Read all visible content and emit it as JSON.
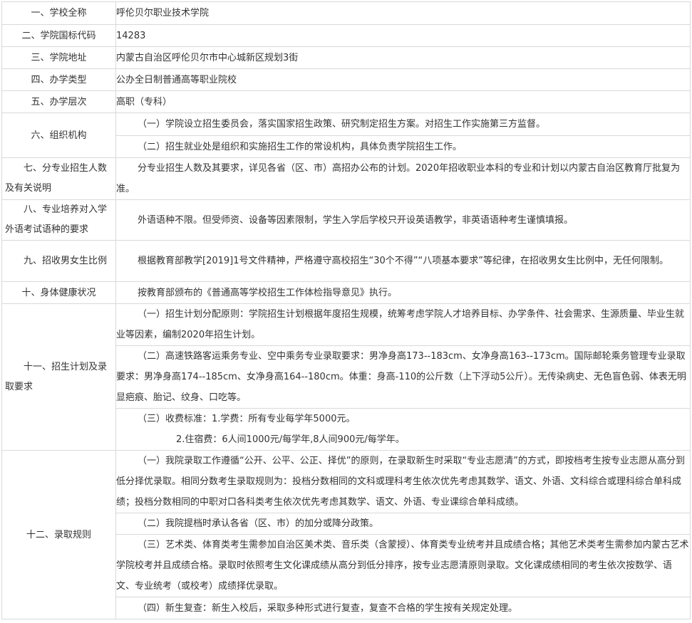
{
  "rows": [
    {
      "label": "一、学校全称",
      "value": "呼伦贝尔职业技术学院"
    },
    {
      "label": "二、学院国标代码",
      "value": "14283"
    },
    {
      "label": "三、学院地址",
      "value": "内蒙古自治区呼伦贝尔市中心城新区规划3街"
    },
    {
      "label": "四、办学类型",
      "value": "公办全日制普通高等职业院校"
    },
    {
      "label": "五、办学层次",
      "value": "高职（专科）"
    }
  ],
  "org": {
    "label": "六、组织机构",
    "items": [
      "（一）学院设立招生委员会，落实国家招生政策、研究制定招生方案。对招生工作实施第三方监督。",
      "（二）招生就业处是组织和实施招生工作的常设机构，具体负责学院招生工作。"
    ]
  },
  "quota": {
    "label": "七、分专业招生人数及有关说明",
    "text": "分专业招生人数及其要求，详见各省（区、市）高招办公布的计划。2020年招收职业本科的专业和计划以内蒙古自治区教育厅批复为准。"
  },
  "lang": {
    "label": "八、专业培养对入学外语考试语种的要求",
    "text": "外语语种不限。但受师资、设备等因素限制，学生入学后学校只开设英语教学，非英语语种考生谨慎填报。"
  },
  "gender": {
    "label": "九、招收男女生比例",
    "text": "根据教育部教学[2019]1号文件精神，严格遵守高校招生“30个不得”“八项基本要求”等纪律，在招收男女生比例中，无任何限制。"
  },
  "health": {
    "label": "十、身体健康状况",
    "text": "按教育部颁布的《普通高等学校招生工作体检指导意见》执行。"
  },
  "plan": {
    "label": "十一、招生计划及录取要求",
    "items": [
      "（一）招生计划分配原则：学院招生计划根据年度招生规模，统筹考虑学院人才培养目标、办学条件、社会需求、生源质量、毕业生就业等因素，编制2020年招生计划。",
      "（二）高速铁路客运乘务专业、空中乘务专业录取要求：男净身高173--183cm、女净身高163--173cm。国际邮轮乘务管理专业录取要求：男净身高174--185cm、女净身高164--180cm。体重：身高-110的公斤数（上下浮动5公斤）。无传染病史、无色盲色弱、体表无明显疤痕、胎记、纹身、口吃等。"
    ],
    "fee_line1": "（三）收费标准：1.学费：所有专业每学年5000元。",
    "fee_line2": "2.住宿费：6人间1000元/每学年,8人间900元/每学年。"
  },
  "rules": {
    "label": "十二、录取规则",
    "items": [
      "（一）我院录取工作遵循“公开、公平、公正、择优”的原则，在录取新生时采取“专业志愿清”的方式，即按档考生按专业志愿从高分到低分择优录取。相同分数考生录取规则为：投档分数相同的文科或理科考生依次优先考虑其数学、语文、外语、文科综合或理科综合单科成绩；投档分数相同的中职对口各科类考生依次优先考虑其数学、语文、外语、专业课综合单科成绩。",
      "（二）我院提档时承认各省（区、市）的加分或降分政策。",
      "（三）艺术类、体育类考生需参加自治区美术类、音乐类（含蒙授）、体育类专业统考并且成绩合格；其他艺术类考生需参加内蒙古艺术学院校考并且成绩合格。录取时依照考生文化课成绩从高分到低分排序，按专业志愿清原则录取。文化课成绩相同的考生依次按数学、语文、专业统考（或校考）成绩择优录取。",
      "（四）新生复查：新生入校后，采取多种形式进行复查，复查不合格的学生按有关规定处理。"
    ]
  }
}
